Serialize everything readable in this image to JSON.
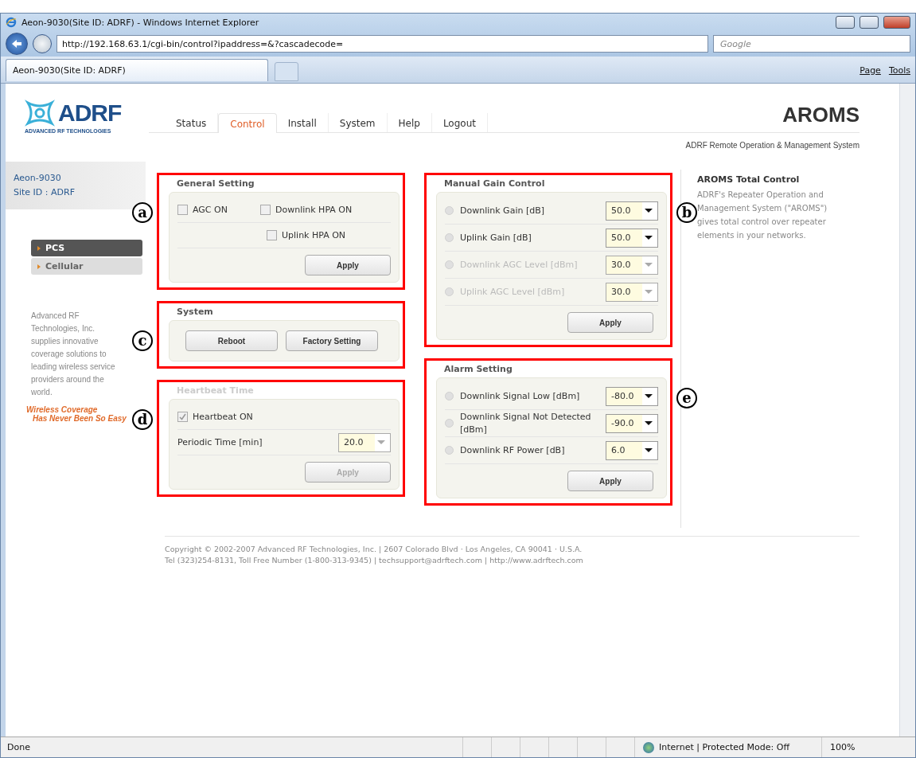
{
  "browser": {
    "title": "Aeon-9030(Site ID: ADRF) - Windows Internet Explorer",
    "address": "http://192.168.63.1/cgi-bin/control?ipaddress=&?cascadecode=",
    "search_placeholder": "Google",
    "tab": "Aeon-9030(Site ID: ADRF)",
    "commands": [
      "Page",
      "Tools"
    ],
    "status": "Done",
    "zone": "Internet | Protected Mode: Off",
    "zoom": "100%"
  },
  "page": {
    "logo": "ADRF",
    "logo_sub": "ADVANCED RF TECHNOLOGIES",
    "nav": [
      {
        "label": "Status",
        "selected": false
      },
      {
        "label": "Control",
        "selected": true
      },
      {
        "label": "Install",
        "selected": false
      },
      {
        "label": "System",
        "selected": false
      },
      {
        "label": "Help",
        "selected": false
      },
      {
        "label": "Logout",
        "selected": false
      }
    ],
    "brand": "AROMS",
    "brand_sub": "ADRF Remote Operation & Management System",
    "device": [
      "Aeon-9030",
      "Site ID : ADRF"
    ],
    "bands": [
      {
        "label": "PCS",
        "selected": true
      },
      {
        "label": "Cellular",
        "selected": false
      }
    ],
    "blurb": "Advanced RF Technologies, Inc. supplies innovative coverage solutions to leading wireless service providers around the world.",
    "slogan": [
      "Wireless Coverage",
      "Has Never Been So Easy"
    ],
    "left_sections": [
      {
        "kind": "checks",
        "title": "General Setting",
        "callout": "a",
        "disabled": false,
        "checks": [
          {
            "label": "AGC ON",
            "checked": false
          },
          {
            "label": "Downlink HPA ON",
            "checked": false
          },
          {
            "label": "Uplink HPA ON",
            "checked": false
          }
        ],
        "apply": "Apply"
      },
      {
        "kind": "buttons",
        "title": "System",
        "callout": "c",
        "disabled": false,
        "buttons": [
          "Reboot",
          "Factory Setting"
        ]
      },
      {
        "kind": "heartbeat",
        "title": "Heartbeat Time",
        "callout": "d",
        "disabled": true,
        "check": {
          "label": "Heartbeat ON",
          "checked": true
        },
        "field": {
          "label": "Periodic Time [min]",
          "value": "20.0"
        },
        "apply": "Apply"
      }
    ],
    "right_sections": [
      {
        "title": "Manual Gain Control",
        "callout": "b",
        "rows": [
          {
            "label": "Downlink Gain [dB]",
            "value": "50.0",
            "disabled": false,
            "selected": false
          },
          {
            "label": "Uplink Gain [dB]",
            "value": "50.0",
            "disabled": false,
            "selected": false
          },
          {
            "label": "Downlink AGC Level [dBm]",
            "value": "30.0",
            "disabled": true,
            "selected": false
          },
          {
            "label": "Uplink AGC Level [dBm]",
            "value": "30.0",
            "disabled": true,
            "selected": false
          }
        ],
        "apply": "Apply"
      },
      {
        "title": "Alarm Setting",
        "callout": "e",
        "rows": [
          {
            "label": "Downlink Signal Low [dBm]",
            "value": "-80.0",
            "disabled": false,
            "selected": false
          },
          {
            "label": "Downlink Signal Not Detected [dBm]",
            "value": "-90.0",
            "disabled": false,
            "selected": false
          },
          {
            "label": "Downlink RF Power [dB]",
            "value": "6.0",
            "disabled": false,
            "selected": false
          }
        ],
        "apply": "Apply"
      }
    ],
    "info_title": "AROMS Total Control",
    "info_text": "ADRF's Repeater Operation and Management System (\"AROMS\") gives total control over repeater elements in your networks.",
    "footer": [
      "Copyright © 2002-2007 Advanced RF Technologies, Inc. | 2607 Colorado Blvd · Los Angeles, CA 90041 · U.S.A.",
      "Tel (323)254-8131, Toll Free Number (1-800-313-9345) | techsupport@adrftech.com | http://www.adrftech.com"
    ]
  }
}
